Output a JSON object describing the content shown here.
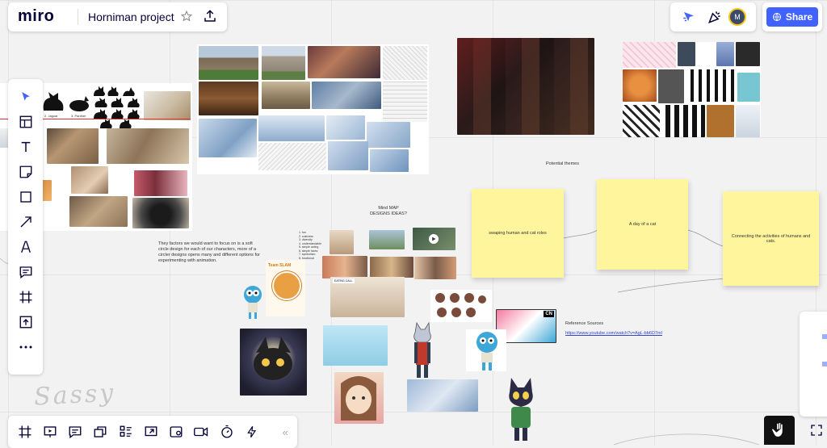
{
  "app": {
    "logo": "miro",
    "board_title": "Horniman project",
    "share_label": "Share",
    "avatar_initial": "M"
  },
  "colors": {
    "accent": "#4262ff",
    "sticky": "#fff59d",
    "link": "#3344cc"
  },
  "toolbar_left": [
    "select-icon",
    "templates-icon",
    "text-icon",
    "sticky-note-icon",
    "shape-icon",
    "arrow-icon",
    "pen-icon",
    "comment-icon",
    "frame-icon",
    "upload-icon",
    "more-icon"
  ],
  "toolbar_bottom": [
    "frames-icon",
    "presentation-icon",
    "comments-icon",
    "cards-icon",
    "kanban-icon",
    "screen-share-icon",
    "video-chat-icon",
    "video-icon",
    "timer-icon",
    "lightning-icon"
  ],
  "collapse_label": "«",
  "board": {
    "mind_map_title": "Mind MAP\nDESIGNS IDEAS?",
    "potential_themes": "Potential themes",
    "reference_sources": "Reference Sources",
    "reference_link": "https://www.youtube.com/watch?v=AgL-bb6D7mI",
    "factors_text": "They factors we would want to focus on is a soft circle design for each of our characters, more of a circler designs opens many and different options for experimenting with animation.",
    "stickies": [
      "swaping human and cat roles",
      "A day of a cat",
      "Connecting the activities of humans and cats."
    ],
    "cat_labels": [
      "1. cat",
      "2. Jaguar",
      "3. Panther"
    ],
    "list_items": [
      "1. fun",
      "2. cuteness",
      "3. diversity",
      "4. understandable",
      "5. simple acting",
      "6. simple faces",
      "7. symbolism",
      "8. functional"
    ],
    "poster_text": [
      "Team SLAM",
      "EATING CALL"
    ],
    "cn_logo": "CN",
    "scribble": "Sassy"
  }
}
